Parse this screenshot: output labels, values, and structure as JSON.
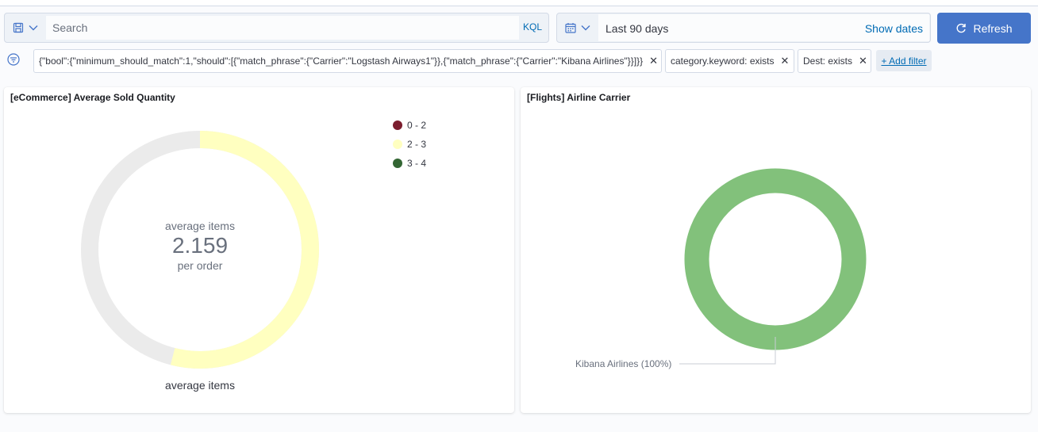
{
  "query_bar": {
    "search_placeholder": "Search",
    "language": "KQL",
    "saved_query_icon": "save-icon",
    "chevron_icon": "chevron-down-icon"
  },
  "date_picker": {
    "range": "Last 90 days",
    "show_dates": "Show dates",
    "calendar_icon": "calendar-icon"
  },
  "refresh": {
    "label": "Refresh",
    "icon": "refresh-icon",
    "color": "#4575c9"
  },
  "filters": {
    "items": [
      {
        "label": "{\"bool\":{\"minimum_should_match\":1,\"should\":[{\"match_phrase\":{\"Carrier\":\"Logstash Airways1\"}},{\"match_phrase\":{\"Carrier\":\"Kibana Airlines\"}}]}}"
      },
      {
        "label": "category.keyword: exists"
      },
      {
        "label": "Dest: exists"
      }
    ],
    "add_filter": "+ Add filter",
    "remove_icon": "close-icon"
  },
  "panels": [
    {
      "title": "[eCommerce] Average Sold Quantity",
      "gauge": {
        "label_top": "average items",
        "value": "2.159",
        "label_bottom": "per order",
        "caption": "average items",
        "min": 0,
        "max": 4,
        "numeric_value": 2.159,
        "fill_color": "#ffffc0",
        "track_color": "#ebebeb"
      },
      "legend": [
        {
          "label": "0 - 2",
          "color": "#7b1d2e"
        },
        {
          "label": "2 - 3",
          "color": "#ffffc0"
        },
        {
          "label": "3 - 4",
          "color": "#336633"
        }
      ]
    },
    {
      "title": "[Flights] Airline Carrier",
      "chart_data": {
        "type": "pie",
        "slices": [
          {
            "label": "Kibana Airlines (100%)",
            "value": 100,
            "color": "#82c17b"
          }
        ]
      }
    }
  ]
}
